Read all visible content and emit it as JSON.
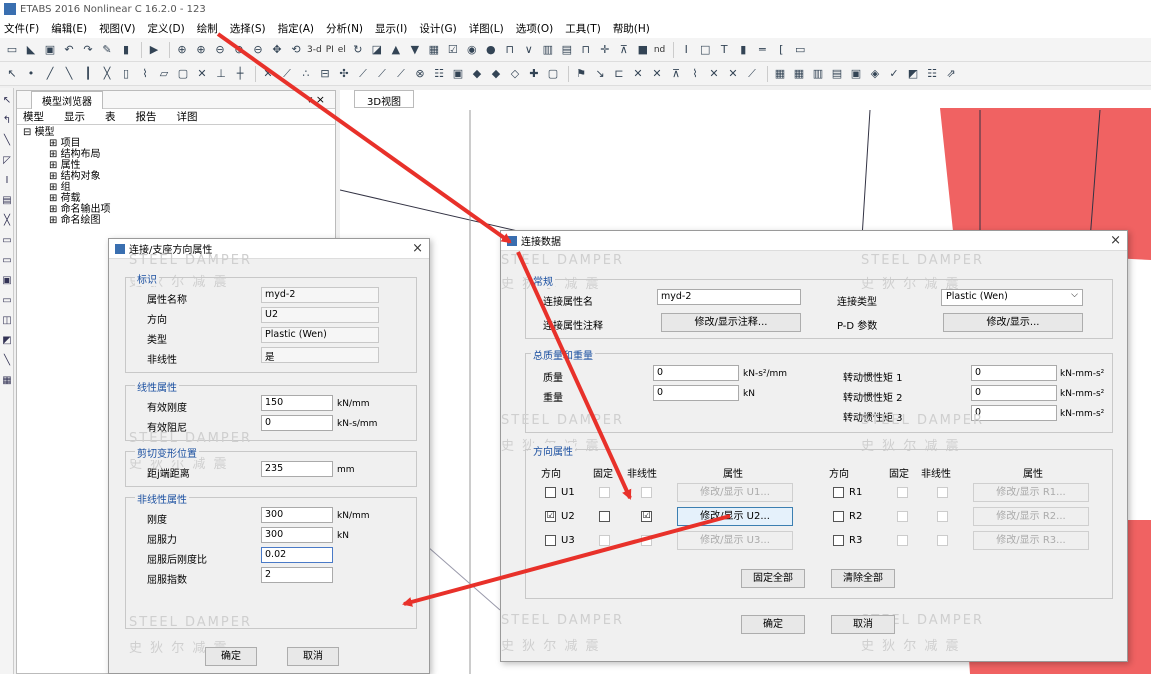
{
  "window": {
    "title": "ETABS 2016 Nonlinear C 16.2.0 - 123"
  },
  "menu": [
    "文件(F)",
    "编辑(E)",
    "视图(V)",
    "定义(D)",
    "绘制",
    "选择(S)",
    "指定(A)",
    "分析(N)",
    "显示(I)",
    "设计(G)",
    "详图(L)",
    "选项(O)",
    "工具(T)",
    "帮助(H)"
  ],
  "toolbar": {
    "text_3d": "3-d",
    "text_plan": "PI",
    "text_elev": "el",
    "text_nd": "nd"
  },
  "browser": {
    "tab_title": "模型浏览器",
    "pin": "▾ ×",
    "tabs": [
      "模型",
      "显示",
      "表",
      "报告",
      "详图"
    ],
    "root": "模型",
    "children": [
      "项目",
      "结构布局",
      "属性",
      "结构对象",
      "组",
      "荷载",
      "命名输出项",
      "命名绘图"
    ]
  },
  "view3d": {
    "tab": "3D视图"
  },
  "watermark": {
    "en": "STEEL DAMPER",
    "cn": "史 狄 尔 减 震"
  },
  "dir_dialog": {
    "title": "连接/支座方向属性",
    "id_group": "标识",
    "prop_name_label": "属性名称",
    "prop_name": "myd-2",
    "direction_label": "方向",
    "direction": "U2",
    "type_label": "类型",
    "type": "Plastic (Wen)",
    "nonlinear_label": "非线性",
    "nonlinear": "是",
    "linear_group": "线性属性",
    "eff_stiff_label": "有效刚度",
    "eff_stiff": "150",
    "eff_stiff_unit": "kN/mm",
    "eff_damp_label": "有效阻尼",
    "eff_damp": "0",
    "eff_damp_unit": "kN-s/mm",
    "shear_group": "剪切变形位置",
    "dist_label": "距j端距离",
    "dist": "235",
    "dist_unit": "mm",
    "nonlin_group": "非线性属性",
    "stiff_label": "刚度",
    "stiff": "300",
    "stiff_unit": "kN/mm",
    "yield_label": "屈服力",
    "yield": "300",
    "yield_unit": "kN",
    "post_label": "屈服后刚度比",
    "post": "0.02",
    "exp_label": "屈服指数",
    "exp": "2",
    "ok": "确定",
    "cancel": "取消"
  },
  "link_dialog": {
    "title": "连接数据",
    "general_group": "常规",
    "link_name_label": "连接属性名",
    "link_name": "myd-2",
    "link_type_label": "连接类型",
    "link_type": "Plastic (Wen)",
    "note_label": "连接属性注释",
    "note_btn": "修改/显示注释...",
    "pd_label": "P-D 参数",
    "pd_btn": "修改/显示...",
    "mass_group": "总质量和重量",
    "mass_label": "质量",
    "mass": "0",
    "mass_unit": "kN-s²/mm",
    "weight_label": "重量",
    "weight": "0",
    "weight_unit": "kN",
    "rot1_label": "转动惯性矩 1",
    "rot1": "0",
    "rot1_unit": "kN-mm-s²",
    "rot2_label": "转动惯性矩 2",
    "rot2": "0",
    "rot2_unit": "kN-mm-s²",
    "rot3_label": "转动惯性矩 3",
    "rot3": "0",
    "rot3_unit": "kN-mm-s²",
    "dir_group": "方向属性",
    "col_dir": "方向",
    "col_fixed": "固定",
    "col_nonlin": "非线性",
    "col_prop": "属性",
    "rows_left": [
      {
        "dir": "U1",
        "checked": "",
        "fixed": "",
        "nonlin": "",
        "btn": "修改/显示 U1..."
      },
      {
        "dir": "U2",
        "checked": "☑",
        "fixed": "",
        "nonlin": "☑",
        "btn": "修改/显示 U2..."
      },
      {
        "dir": "U3",
        "checked": "",
        "fixed": "",
        "nonlin": "",
        "btn": "修改/显示 U3..."
      }
    ],
    "rows_right": [
      {
        "dir": "R1",
        "btn": "修改/显示 R1..."
      },
      {
        "dir": "R2",
        "btn": "修改/显示 R2..."
      },
      {
        "dir": "R3",
        "btn": "修改/显示 R3..."
      }
    ],
    "fix_all": "固定全部",
    "clear_all": "清除全部",
    "ok": "确定",
    "cancel": "取消"
  },
  "colors": {
    "arrow": "#e8312a",
    "model_fill": "#f06262",
    "accent": "#1a4fa0"
  }
}
